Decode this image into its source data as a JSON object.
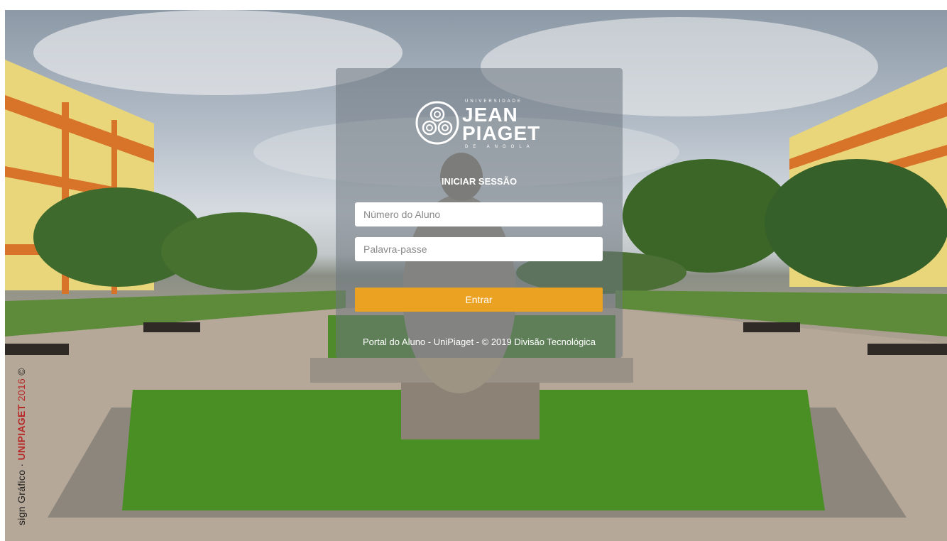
{
  "background": {
    "credit_prefix": "sign Gráfico · ",
    "credit_brand": "UNIPIAGET",
    "credit_year": " 2016 ",
    "credit_symbol": "©"
  },
  "logo": {
    "top_text": "UNIVERSIDADE",
    "line1": "JEAN",
    "line2": "PIAGET",
    "bottom_text": "DE ANGOLA"
  },
  "login": {
    "title": "INICIAR SESSÃO",
    "student_number_placeholder": "Número do Aluno",
    "password_placeholder": "Palavra-passe",
    "submit_label": "Entrar",
    "footer": "Portal do Aluno - UniPiaget - © 2019 Divisão Tecnológica"
  },
  "colors": {
    "accent": "#eba222",
    "panel": "rgba(110,118,128,0.55)"
  }
}
